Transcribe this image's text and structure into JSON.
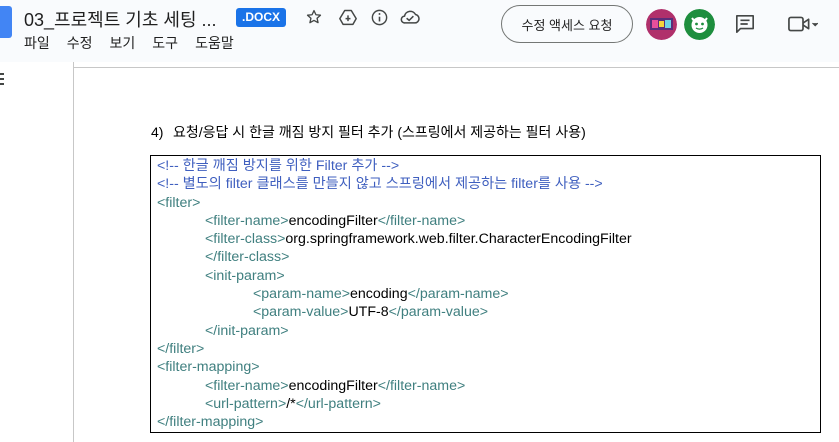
{
  "header": {
    "title": "03_프로젝트 기초 세팅 ...",
    "badge": ".DOCX",
    "menu": [
      "파일",
      "수정",
      "보기",
      "도구",
      "도움말"
    ],
    "access_button": "수정 액세스 요청"
  },
  "content": {
    "heading_number": "4)",
    "heading_text": "요청/응답 시 한글 깨짐 방지 필터 추가 (스프링에서 제공하는 필터 사용)",
    "code": {
      "comment1": "<!-- 한글 깨짐 방지를 위한 Filter 추가 -->",
      "comment2": "<!-- 별도의 filter 클래스를 만들지 않고 스프링에서 제공하는 filter를 사용 -->",
      "filter_open": "<filter>",
      "fn_open": "<filter-name>",
      "fn_value": "encodingFilter",
      "fn_close": "</filter-name>",
      "fc_open": "<filter-class>",
      "fc_value": "org.springframework.web.filter.CharacterEncodingFilter",
      "fc_close": "</filter-class>",
      "ip_open": "<init-param>",
      "pn_open": "<param-name>",
      "pn_value": "encoding",
      "pn_close": "</param-name>",
      "pv_open": "<param-value>",
      "pv_value": "UTF-8",
      "pv_close": "</param-value>",
      "ip_close": "</init-param>",
      "filter_close": "</filter>",
      "fm_open": "<filter-mapping>",
      "fm_fn_open": "<filter-name>",
      "fm_fn_value": "encodingFilter",
      "fm_fn_close": "</filter-name>",
      "up_open": "<url-pattern>",
      "up_value": "/*",
      "up_close": "</url-pattern>",
      "fm_close": "</filter-mapping>"
    }
  },
  "icons": {
    "star": "star-icon",
    "move": "move-to-drive-icon",
    "info": "info-icon",
    "cloud": "cloud-status-icon",
    "comments": "comments-icon",
    "meet": "video-call-icon"
  },
  "colors": {
    "badge": "#1a73e8",
    "comment": "#3f5fbf",
    "tag": "#3f7f7f",
    "avatar_green": "#1e8e3e"
  }
}
